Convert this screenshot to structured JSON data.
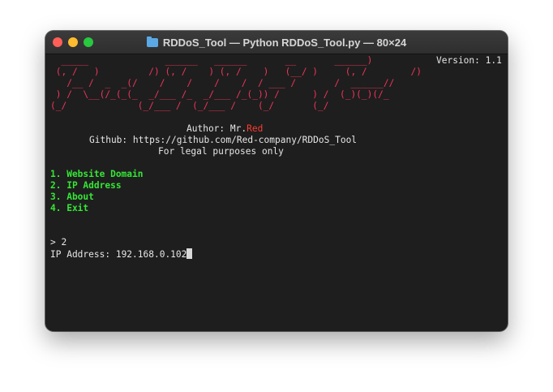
{
  "window": {
    "title": "RDDoS_Tool — Python RDDoS_Tool.py — 80×24"
  },
  "terminal": {
    "version": "Version: 1.1",
    "banner": [
      "  _____              ______   ______       __       ______)",
      " (, /   )         /) (, /    ) (, /    )   (__/ )     (, /        /)",
      "   /__ /  _  _(/    /    /    /    /  / ___ /       /  ______//",
      " ) /  \\__(/_(_(_  _/___ /_  _/___ /_(_)) /      ) /  (_)(_)(/_",
      "(_/             (_/___ /  (_/___ /    (_/       (_/"
    ],
    "author_prefix": "Author: Mr.",
    "author_name": "Red",
    "github": "Github: https://github.com/Red-company/RDDoS_Tool",
    "legal": "For legal purposes only",
    "menu": [
      "1. Website Domain",
      "2. IP Address",
      "3. About",
      "4. Exit"
    ],
    "prompt": "> 2",
    "input_label": "IP Address: ",
    "input_value": "192.168.0.102"
  },
  "colors": {
    "terminal_bg": "#1e1e1e",
    "menu_green": "#35e635",
    "author_red": "#ff3b30"
  }
}
